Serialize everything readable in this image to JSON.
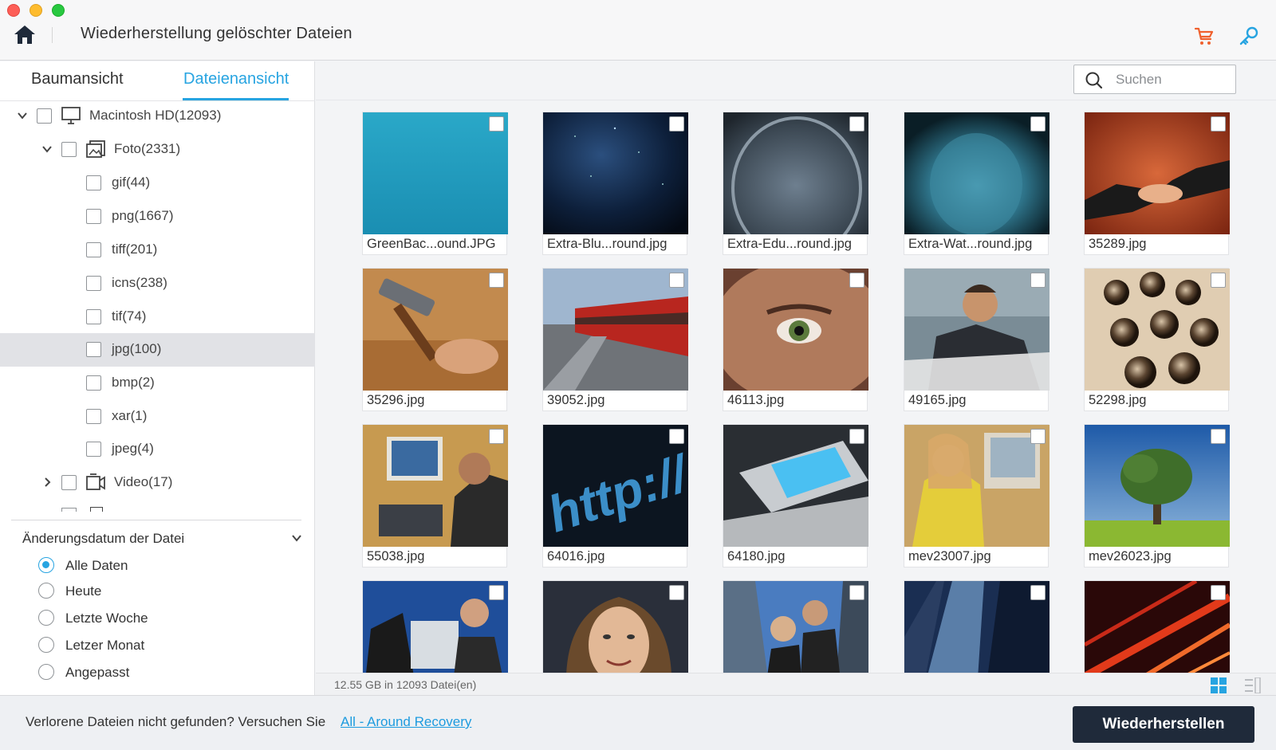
{
  "window": {
    "title": "Wiederherstellung gelöschter Dateien",
    "icons": [
      "home-icon",
      "cart-icon",
      "key-icon"
    ],
    "accent_color": "#27a4e1"
  },
  "tabs": {
    "tree": "Baumansicht",
    "file": "Dateienansicht",
    "active": "Dateienansicht"
  },
  "tree": {
    "root": "Macintosh HD(12093)",
    "photo": "Foto(2331)",
    "types": [
      "gif(44)",
      "png(1667)",
      "tiff(201)",
      "icns(238)",
      "tif(74)",
      "jpg(100)",
      "bmp(2)",
      "xar(1)",
      "jpeg(4)"
    ],
    "selected": "jpg(100)",
    "video": "Video(17)"
  },
  "filter": {
    "title": "Änderungsdatum der Datei",
    "options": [
      "Alle Daten",
      "Heute",
      "Letzte Woche",
      "Letzer Monat",
      "Angepasst"
    ],
    "selected": "Alle Daten"
  },
  "search": {
    "placeholder": "Suchen"
  },
  "files": [
    {
      "name": "GreenBac...ound.JPG",
      "checked": false
    },
    {
      "name": "Extra-Blu...round.jpg",
      "checked": false
    },
    {
      "name": "Extra-Edu...round.jpg",
      "checked": false
    },
    {
      "name": "Extra-Wat...round.jpg",
      "checked": false
    },
    {
      "name": "35289.jpg",
      "checked": false
    },
    {
      "name": "35296.jpg",
      "checked": false
    },
    {
      "name": "39052.jpg",
      "checked": false
    },
    {
      "name": "46113.jpg",
      "checked": false
    },
    {
      "name": "49165.jpg",
      "checked": false
    },
    {
      "name": "52298.jpg",
      "checked": false
    },
    {
      "name": "55038.jpg",
      "checked": false
    },
    {
      "name": "64016.jpg",
      "checked": false
    },
    {
      "name": "64180.jpg",
      "checked": false
    },
    {
      "name": "mev23007.jpg",
      "checked": false
    },
    {
      "name": "mev26023.jpg",
      "checked": false
    },
    {
      "name": "",
      "checked": false
    },
    {
      "name": "",
      "checked": false
    },
    {
      "name": "",
      "checked": false
    },
    {
      "name": "",
      "checked": false
    },
    {
      "name": "",
      "checked": false
    }
  ],
  "status": {
    "summary": "12.55 GB in 12093 Datei(en)",
    "view_mode": "grid"
  },
  "footer": {
    "message": "Verlorene Dateien nicht gefunden? Versuchen Sie",
    "link": "All - Around Recovery",
    "restore_button": "Wiederherstellen"
  }
}
